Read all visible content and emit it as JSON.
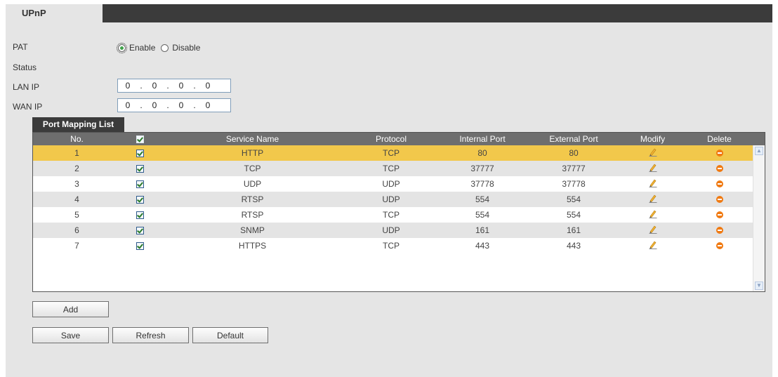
{
  "header": {
    "tab_label": "UPnP"
  },
  "form": {
    "pat_label": "PAT",
    "enable_label": "Enable",
    "disable_label": "Disable",
    "pat_value": "Enable",
    "status_label": "Status",
    "lan_ip_label": "LAN IP",
    "lan_ip": [
      "0",
      "0",
      "0",
      "0"
    ],
    "wan_ip_label": "WAN IP",
    "wan_ip": [
      "0",
      "0",
      "0",
      "0"
    ]
  },
  "port_mapping": {
    "tab_label": "Port Mapping List",
    "columns": {
      "no": "No.",
      "service_name": "Service Name",
      "protocol": "Protocol",
      "internal_port": "Internal Port",
      "external_port": "External Port",
      "modify": "Modify",
      "delete": "Delete"
    },
    "rows": [
      {
        "no": "1",
        "checked": true,
        "service": "HTTP",
        "protocol": "TCP",
        "internal": "80",
        "external": "80",
        "selected": true
      },
      {
        "no": "2",
        "checked": true,
        "service": "TCP",
        "protocol": "TCP",
        "internal": "37777",
        "external": "37777",
        "selected": false
      },
      {
        "no": "3",
        "checked": true,
        "service": "UDP",
        "protocol": "UDP",
        "internal": "37778",
        "external": "37778",
        "selected": false
      },
      {
        "no": "4",
        "checked": true,
        "service": "RTSP",
        "protocol": "UDP",
        "internal": "554",
        "external": "554",
        "selected": false
      },
      {
        "no": "5",
        "checked": true,
        "service": "RTSP",
        "protocol": "TCP",
        "internal": "554",
        "external": "554",
        "selected": false
      },
      {
        "no": "6",
        "checked": true,
        "service": "SNMP",
        "protocol": "UDP",
        "internal": "161",
        "external": "161",
        "selected": false
      },
      {
        "no": "7",
        "checked": true,
        "service": "HTTPS",
        "protocol": "TCP",
        "internal": "443",
        "external": "443",
        "selected": false
      }
    ]
  },
  "buttons": {
    "add": "Add",
    "save": "Save",
    "refresh": "Refresh",
    "default": "Default"
  },
  "icons": {
    "modify": "pencil-icon",
    "delete": "delete-icon"
  },
  "colors": {
    "selected_row": "#f2c84b",
    "header_bg": "#6e6e6e",
    "topbar": "#3b3b3b",
    "delete_icon": "#f07a12"
  }
}
